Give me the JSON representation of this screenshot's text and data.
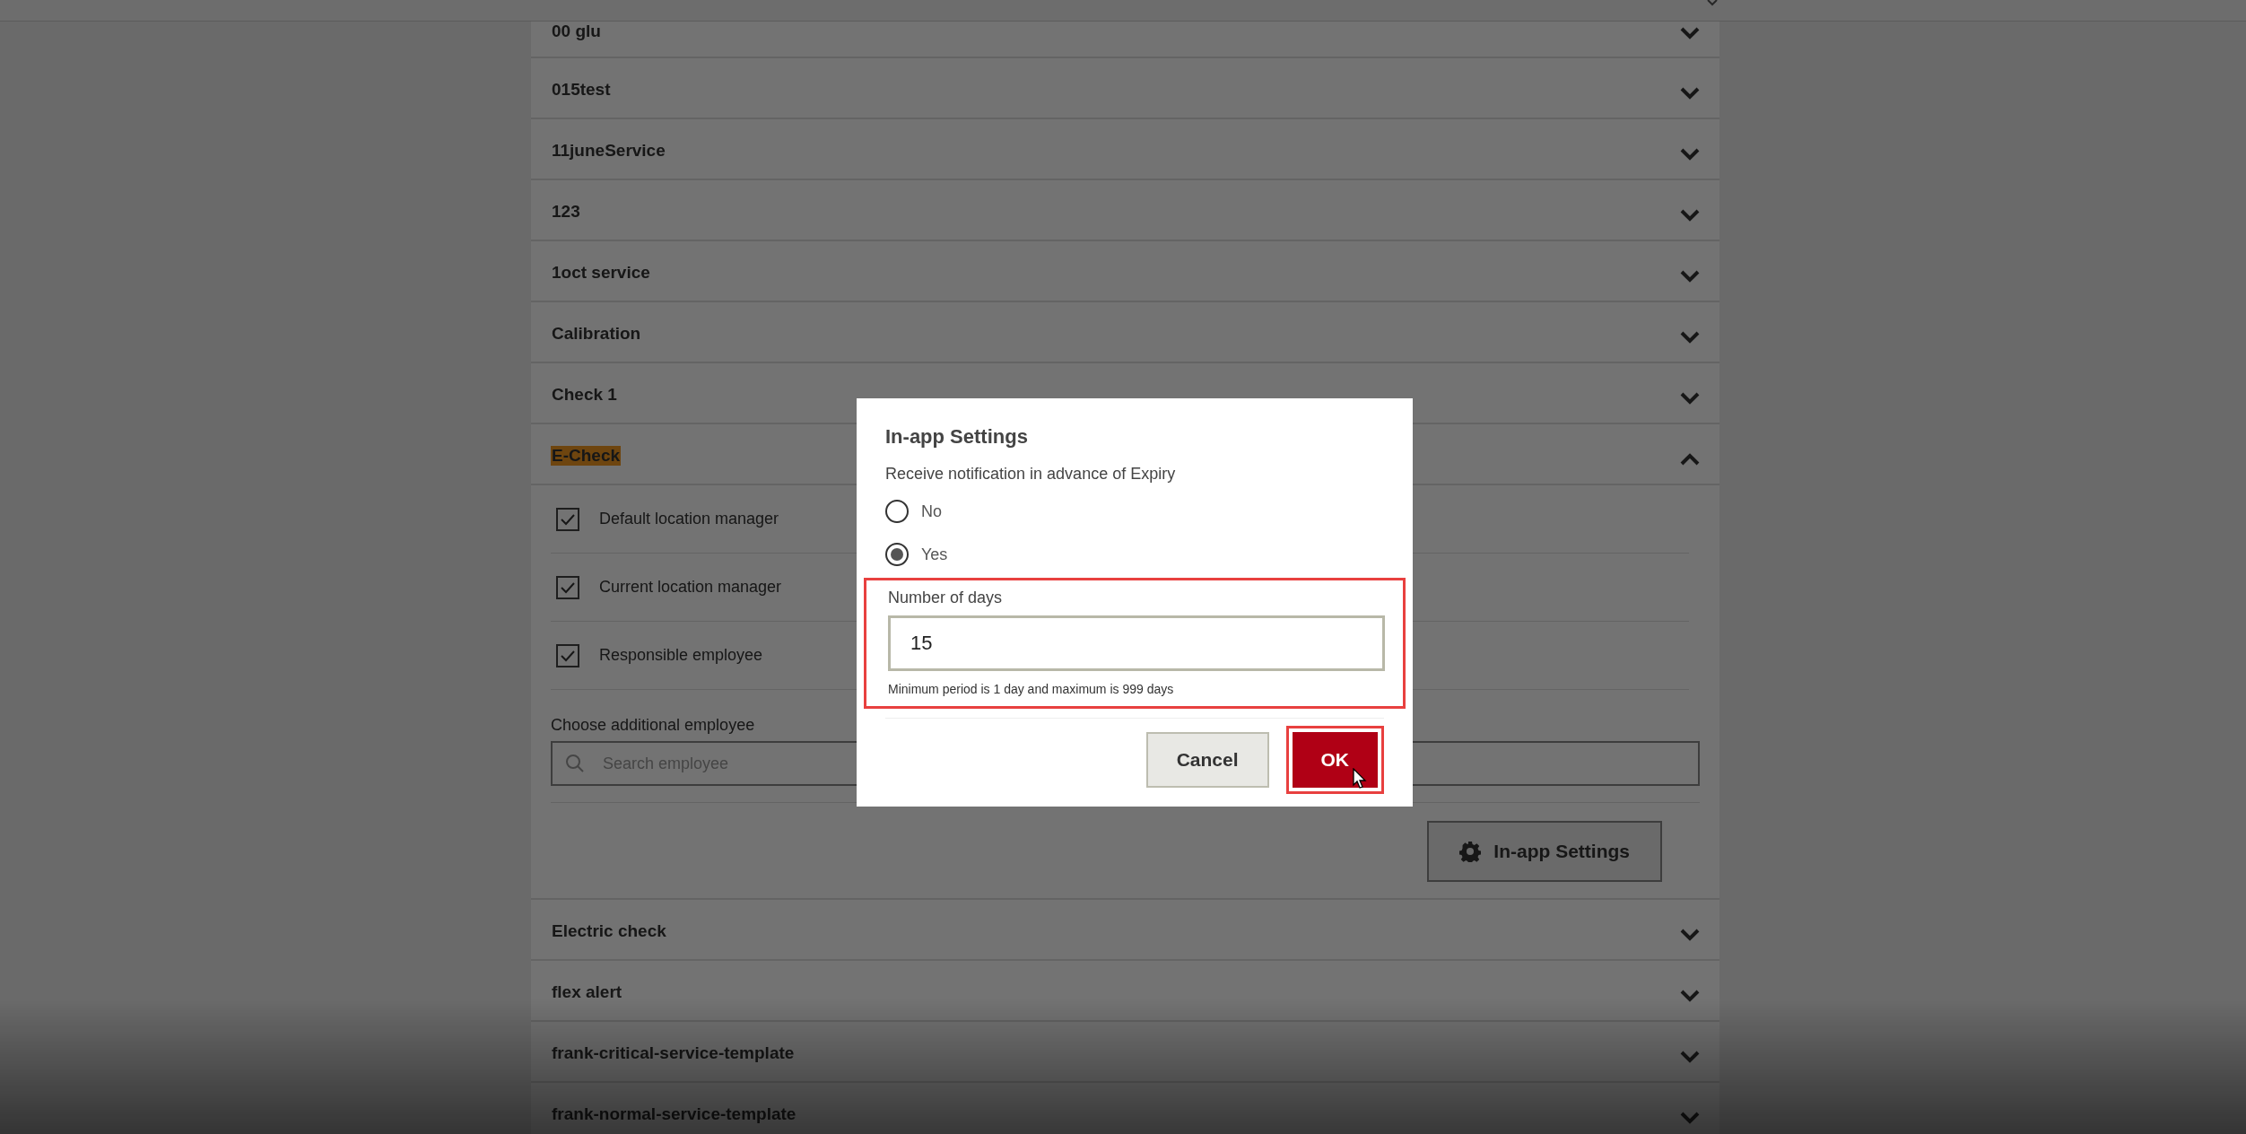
{
  "services": [
    {
      "name": "00 glu",
      "expanded": false,
      "highlighted": false
    },
    {
      "name": "015test",
      "expanded": false,
      "highlighted": false
    },
    {
      "name": "11juneService",
      "expanded": false,
      "highlighted": false
    },
    {
      "name": "123",
      "expanded": false,
      "highlighted": false
    },
    {
      "name": "1oct service",
      "expanded": false,
      "highlighted": false
    },
    {
      "name": "Calibration",
      "expanded": false,
      "highlighted": false
    },
    {
      "name": "Check 1",
      "expanded": false,
      "highlighted": false
    },
    {
      "name": "E-Check",
      "expanded": true,
      "highlighted": true,
      "recipients": [
        {
          "label": "Default location manager",
          "checked": true
        },
        {
          "label": "Current location manager",
          "checked": true
        },
        {
          "label": "Responsible employee",
          "checked": true
        }
      ],
      "additional_employee": {
        "label": "Choose additional employee",
        "placeholder": "Search employee"
      },
      "settings_button": "In-app Settings"
    },
    {
      "name": "Electric check",
      "expanded": false,
      "highlighted": false
    },
    {
      "name": "flex alert",
      "expanded": false,
      "highlighted": false
    },
    {
      "name": "frank-critical-service-template",
      "expanded": false,
      "highlighted": false
    },
    {
      "name": "frank-normal-service-template",
      "expanded": false,
      "highlighted": false
    }
  ],
  "dialog": {
    "title": "In-app Settings",
    "question": "Receive notification in advance of Expiry",
    "options": [
      {
        "label": "No",
        "selected": false
      },
      {
        "label": "Yes",
        "selected": true
      }
    ],
    "days": {
      "label": "Number of days",
      "value": "15",
      "hint": "Minimum period is 1 day and maximum is 999 days",
      "annotated": true
    },
    "buttons": [
      {
        "label": "Cancel",
        "kind": "secondary",
        "annotated": false
      },
      {
        "label": "OK",
        "kind": "primary",
        "annotated": true
      }
    ]
  }
}
